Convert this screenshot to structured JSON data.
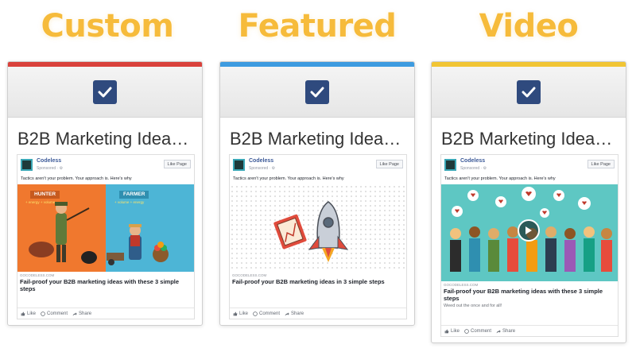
{
  "headings": [
    "Custom",
    "Featured",
    "Video"
  ],
  "colors": {
    "heading": "#f6bb3b",
    "custom_bar": "#d9413b",
    "featured_bar": "#3d9be0",
    "video_bar": "#f1c534",
    "checkbox": "#2f4a7e"
  },
  "cards": [
    {
      "title": "B2B Marketing Idea…",
      "brand": "Codeless",
      "sponsored": "Sponsored · ⚙",
      "like_page": "Like Page",
      "body_text": "Tactics aren't your problem. Your approach is. Here's why",
      "domain": "GOCODELESS.COM",
      "headline": "Fail-proof your B2B marketing ideas with these 3 simple steps",
      "image_labels": {
        "left": "HUNTER",
        "right": "FARMER",
        "left_sub": "+ energy  + volume",
        "right_sub": "+ volume  + energy"
      },
      "actions": {
        "like": "Like",
        "comment": "Comment",
        "share": "Share"
      }
    },
    {
      "title": "B2B Marketing Idea…",
      "brand": "Codeless",
      "sponsored": "Sponsored · ⚙",
      "like_page": "Like Page",
      "body_text": "Tactics aren't your problem. Your approach is. Here's why",
      "domain": "GOCODELESS.COM",
      "headline": "Fail-proof your B2B marketing ideas in 3 simple steps",
      "actions": {
        "like": "Like",
        "comment": "Comment",
        "share": "Share"
      }
    },
    {
      "title": "B2B Marketing Idea…",
      "brand": "Codeless",
      "sponsored": "Sponsored · ⚙",
      "like_page": "Like Page",
      "body_text": "Tactics aren't your problem. Your approach is. Here's why",
      "domain": "GOCODELESS.COM",
      "headline": "Fail-proof your B2B marketing ideas with these 3 simple steps",
      "description": "Weed out the once and for all!",
      "actions": {
        "like": "Like",
        "comment": "Comment",
        "share": "Share"
      }
    }
  ]
}
